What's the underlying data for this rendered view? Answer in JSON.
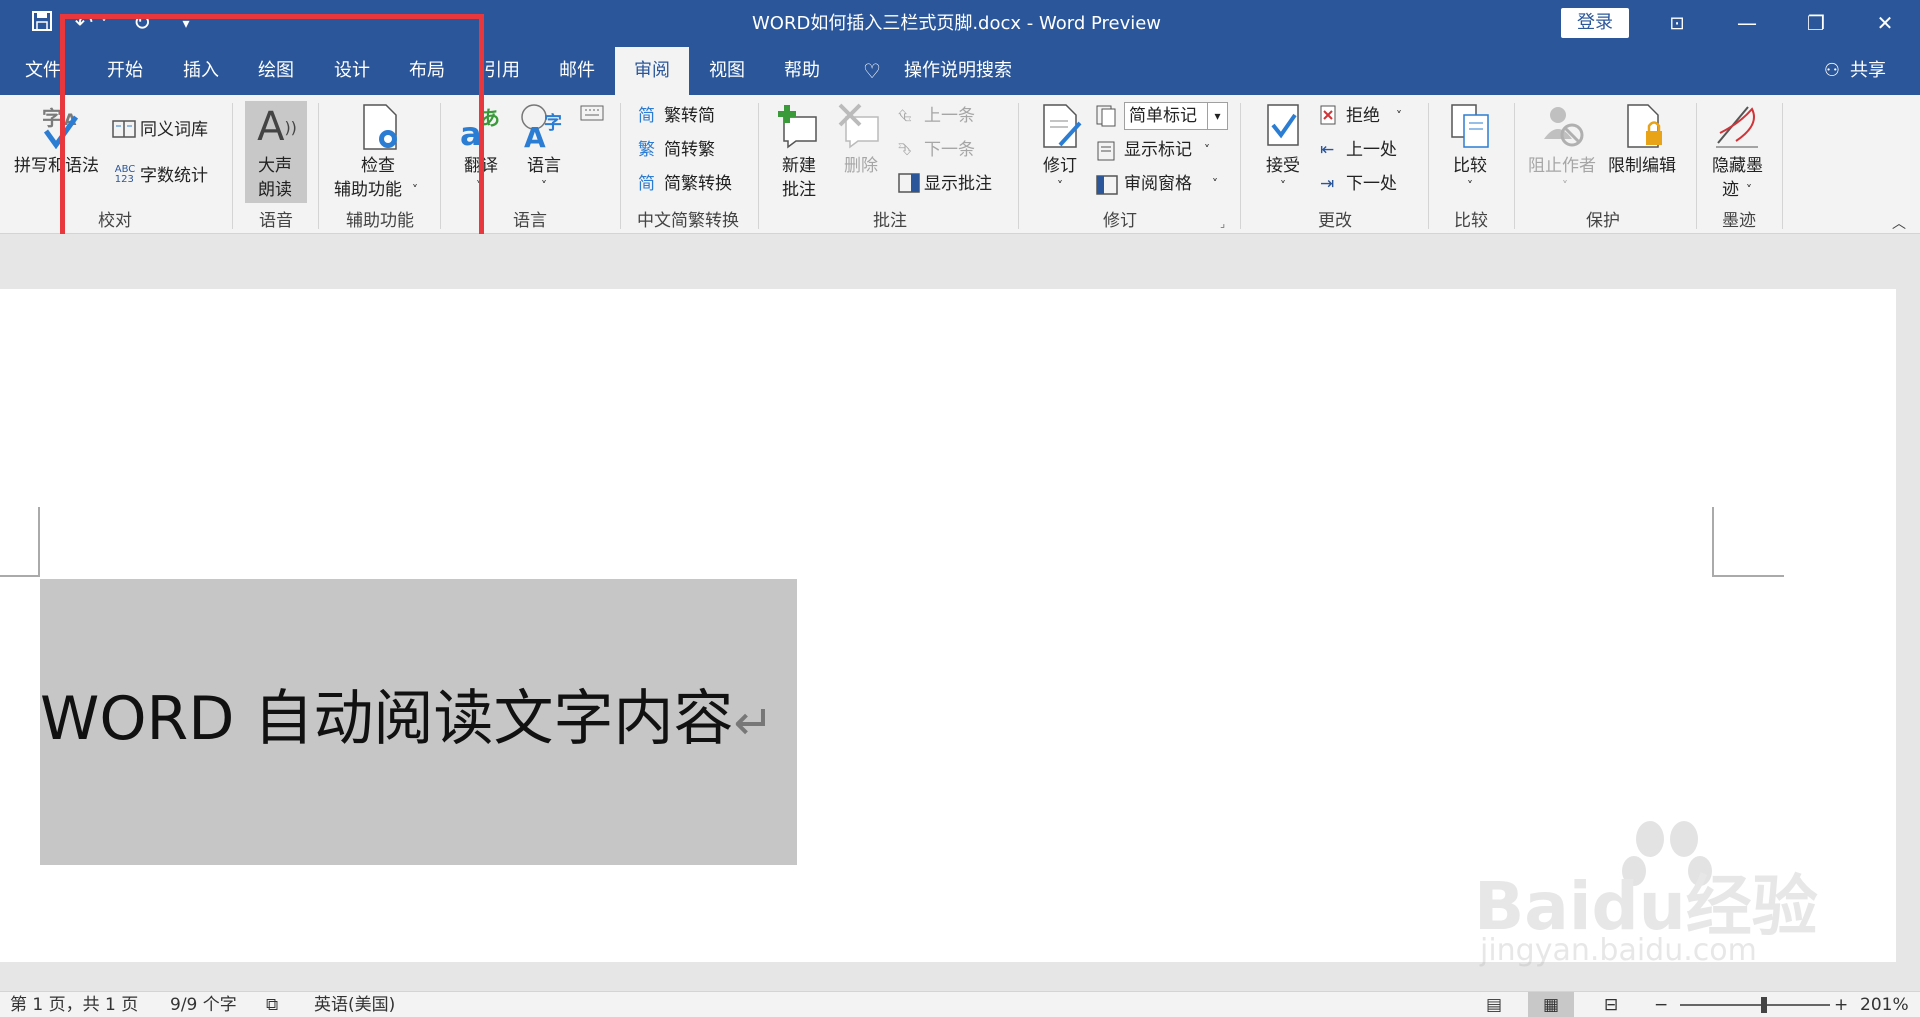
{
  "titlebar": {
    "title": "WORD如何插入三栏式页脚.docx  -  Word Preview",
    "login": "登录",
    "minimize": "—",
    "restore": "❐",
    "close": "✕"
  },
  "quickaccess": {
    "save": "save-icon",
    "undo": "undo-icon",
    "redo": "redo-icon",
    "more": "▾"
  },
  "tabs": [
    "文件",
    "开始",
    "插入",
    "绘图",
    "设计",
    "布局",
    "引用",
    "邮件",
    "审阅",
    "视图",
    "帮助"
  ],
  "active_tab": "审阅",
  "tell_me": "操作说明搜索",
  "share": "共享",
  "ribbon": {
    "proofing": {
      "spelling": "拼写和语法",
      "thesaurus": "同义词库",
      "wordcount": "字数统计",
      "group": "校对"
    },
    "speech": {
      "read_aloud_1": "大声",
      "read_aloud_2": "朗读",
      "group": "语音"
    },
    "accessibility": {
      "check_1": "检查",
      "check_2": "辅助功能",
      "group": "辅助功能"
    },
    "language": {
      "translate": "翻译",
      "language": "语言",
      "group": "语言"
    },
    "chinese": {
      "t2s": "繁转简",
      "s2t": "简转繁",
      "convert": "简繁转换",
      "group": "中文简繁转换"
    },
    "comments": {
      "new_1": "新建",
      "new_2": "批注",
      "delete": "删除",
      "prev": "上一条",
      "next": "下一条",
      "show": "显示批注",
      "group": "批注"
    },
    "tracking": {
      "track": "修订",
      "markup_select": "简单标记",
      "show_markup": "显示标记",
      "review_pane": "审阅窗格",
      "group": "修订"
    },
    "changes": {
      "accept": "接受",
      "reject": "拒绝",
      "prev": "上一处",
      "next": "下一处",
      "group": "更改"
    },
    "compare": {
      "compare": "比较",
      "group": "比较"
    },
    "protect": {
      "block": "阻止作者",
      "restrict": "限制编辑",
      "group": "保护"
    },
    "ink": {
      "hide_1": "隐藏墨",
      "hide_2": "迹",
      "group": "墨迹"
    }
  },
  "document": {
    "text": "WORD 自动阅读文字内容",
    "para_mark": "↵"
  },
  "statusbar": {
    "page": "第 1 页，共 1 页",
    "words": "9/9 个字",
    "lang": "英语(美国)",
    "zoom": "201%",
    "minus": "−",
    "plus": "+"
  },
  "watermark": {
    "brand": "Baidu经验",
    "url": "jingyan.baidu.com"
  },
  "colors": {
    "accent": "#2b579a",
    "highlight_box": "#e8383d",
    "selection": "#c6c6c6"
  }
}
